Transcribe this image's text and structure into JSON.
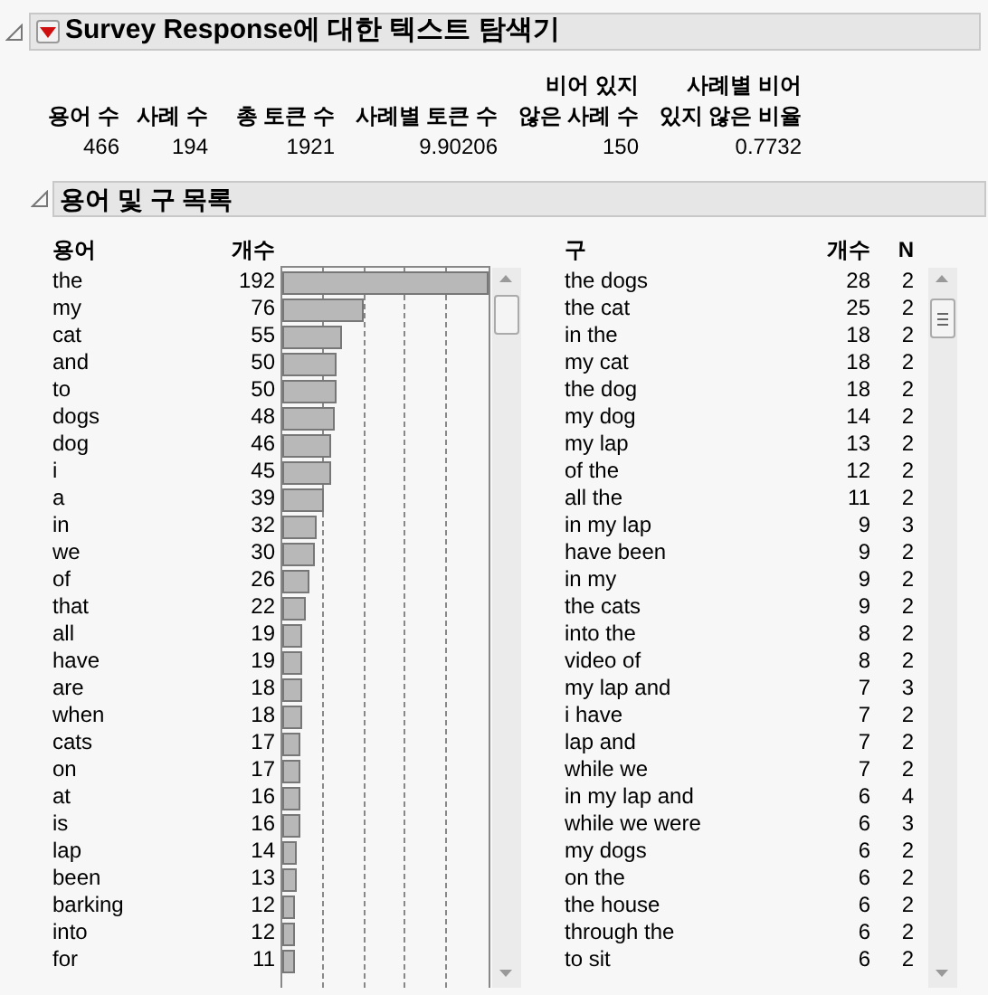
{
  "report": {
    "title": "Survey Response에 대한 텍스트 탐색기",
    "expanded": true
  },
  "summary": {
    "columns": [
      {
        "header": [
          "용어 수"
        ],
        "value": "466"
      },
      {
        "header": [
          "사례 수"
        ],
        "value": "194"
      },
      {
        "header": [
          "총 토큰 수"
        ],
        "value": "1921"
      },
      {
        "header": [
          "사례별 토큰 수"
        ],
        "value": "9.90206"
      },
      {
        "header": [
          "비어 있지",
          "않은 사례 수"
        ],
        "value": "150"
      },
      {
        "header": [
          "사례별 비어",
          "있지 않은 비율"
        ],
        "value": "0.7732"
      }
    ]
  },
  "term_section": {
    "title": "용어 및 구 목록",
    "expanded": true
  },
  "terms": {
    "columns": [
      "용어",
      "개수"
    ],
    "rows": [
      [
        "the",
        "192"
      ],
      [
        "my",
        "76"
      ],
      [
        "cat",
        "55"
      ],
      [
        "and",
        "50"
      ],
      [
        "to",
        "50"
      ],
      [
        "dogs",
        "48"
      ],
      [
        "dog",
        "46"
      ],
      [
        "i",
        "45"
      ],
      [
        "a",
        "39"
      ],
      [
        "in",
        "32"
      ],
      [
        "we",
        "30"
      ],
      [
        "of",
        "26"
      ],
      [
        "that",
        "22"
      ],
      [
        "all",
        "19"
      ],
      [
        "have",
        "19"
      ],
      [
        "are",
        "18"
      ],
      [
        "when",
        "18"
      ],
      [
        "cats",
        "17"
      ],
      [
        "on",
        "17"
      ],
      [
        "at",
        "16"
      ],
      [
        "is",
        "16"
      ],
      [
        "lap",
        "14"
      ],
      [
        "been",
        "13"
      ],
      [
        "barking",
        "12"
      ],
      [
        "into",
        "12"
      ],
      [
        "for",
        "11"
      ]
    ]
  },
  "phrases": {
    "columns": [
      "구",
      "개수",
      "N"
    ],
    "rows": [
      [
        "the dogs",
        "28",
        "2"
      ],
      [
        "the cat",
        "25",
        "2"
      ],
      [
        "in the",
        "18",
        "2"
      ],
      [
        "my cat",
        "18",
        "2"
      ],
      [
        "the dog",
        "18",
        "2"
      ],
      [
        "my dog",
        "14",
        "2"
      ],
      [
        "my lap",
        "13",
        "2"
      ],
      [
        "of the",
        "12",
        "2"
      ],
      [
        "all the",
        "11",
        "2"
      ],
      [
        "in my lap",
        "9",
        "3"
      ],
      [
        "have been",
        "9",
        "2"
      ],
      [
        "in my",
        "9",
        "2"
      ],
      [
        "the cats",
        "9",
        "2"
      ],
      [
        "into the",
        "8",
        "2"
      ],
      [
        "video of",
        "8",
        "2"
      ],
      [
        "my lap and",
        "7",
        "3"
      ],
      [
        "i have",
        "7",
        "2"
      ],
      [
        "lap and",
        "7",
        "2"
      ],
      [
        "while we",
        "7",
        "2"
      ],
      [
        "in my lap and",
        "6",
        "4"
      ],
      [
        "while we were",
        "6",
        "3"
      ],
      [
        "my dogs",
        "6",
        "2"
      ],
      [
        "on the",
        "6",
        "2"
      ],
      [
        "the house",
        "6",
        "2"
      ],
      [
        "through the",
        "6",
        "2"
      ],
      [
        "to sit",
        "6",
        "2"
      ]
    ]
  }
}
